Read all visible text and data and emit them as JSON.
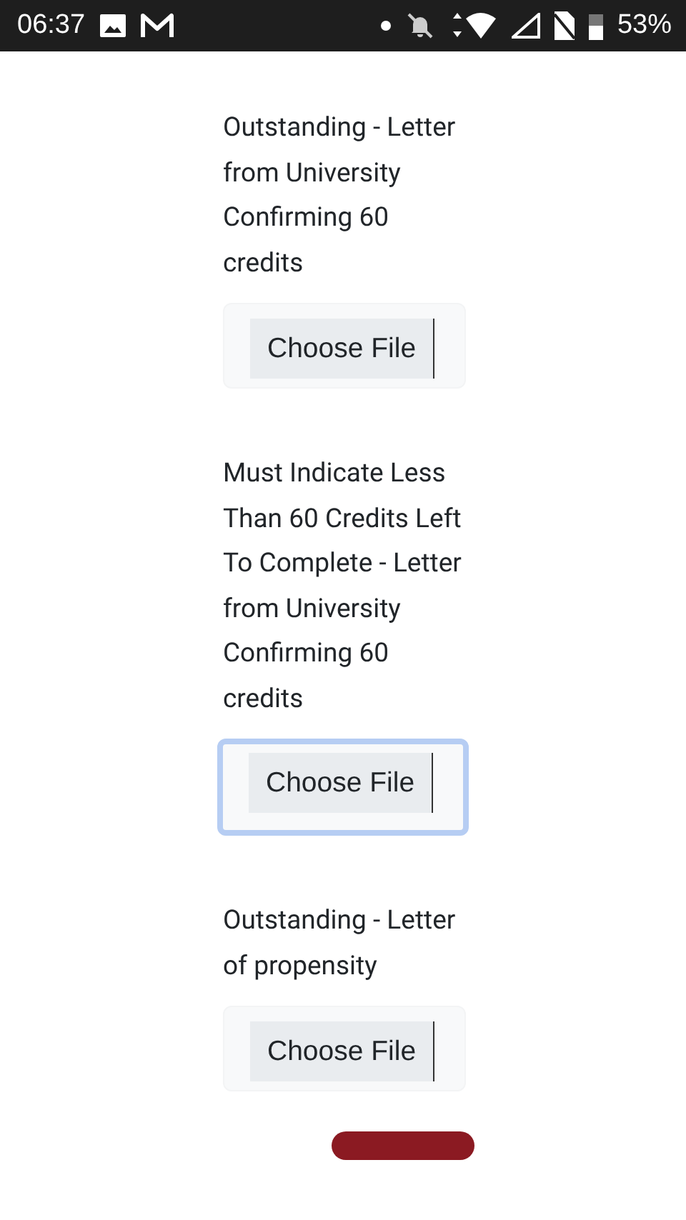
{
  "status_bar": {
    "time": "06:37",
    "battery": "53%"
  },
  "uploads": [
    {
      "label": "Outstanding - Letter from University Confirming 60 credits",
      "button": "Choose File",
      "focused": false
    },
    {
      "label": "Must Indicate Less Than 60 Credits Left To Complete - Letter from University Confirming 60 credits",
      "button": "Choose File",
      "focused": true
    },
    {
      "label": "Outstanding - Letter of propensity",
      "button": "Choose File",
      "focused": false
    }
  ]
}
